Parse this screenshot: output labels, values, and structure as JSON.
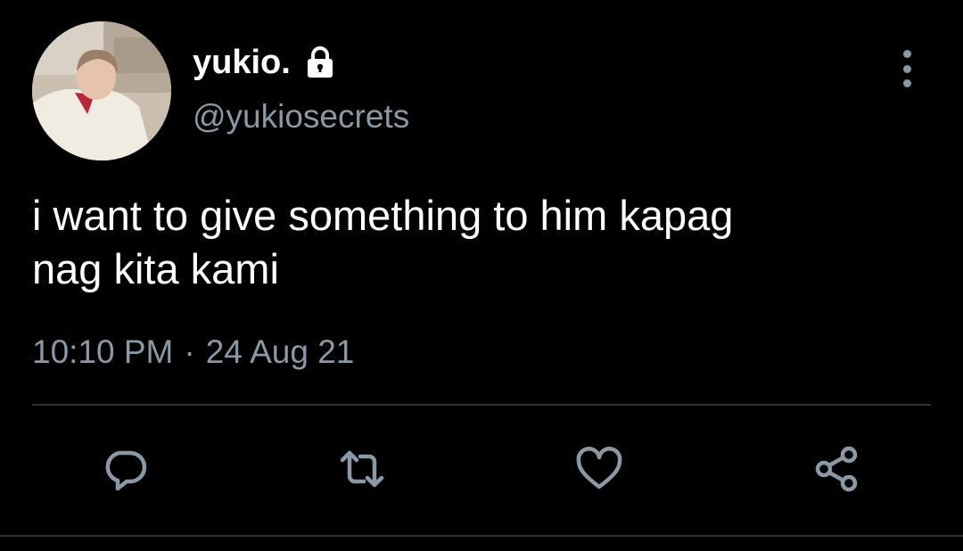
{
  "author": {
    "display_name": "yukio.",
    "handle": "@yukiosecrets",
    "protected_icon": "lock-icon"
  },
  "tweet": {
    "text": "i want to give something to him kapag\nnag kita kami",
    "time": "10:10 PM",
    "separator": "·",
    "date": "24 Aug 21"
  },
  "actions": [
    {
      "name": "reply",
      "icon": "reply-bubble-icon"
    },
    {
      "name": "retweet",
      "icon": "retweet-icon"
    },
    {
      "name": "like",
      "icon": "heart-icon"
    },
    {
      "name": "share",
      "icon": "share-icon"
    }
  ],
  "colors": {
    "background": "#000000",
    "primary_text": "#ffffff",
    "secondary_text": "#8b98a5",
    "divider": "#2f3336"
  }
}
